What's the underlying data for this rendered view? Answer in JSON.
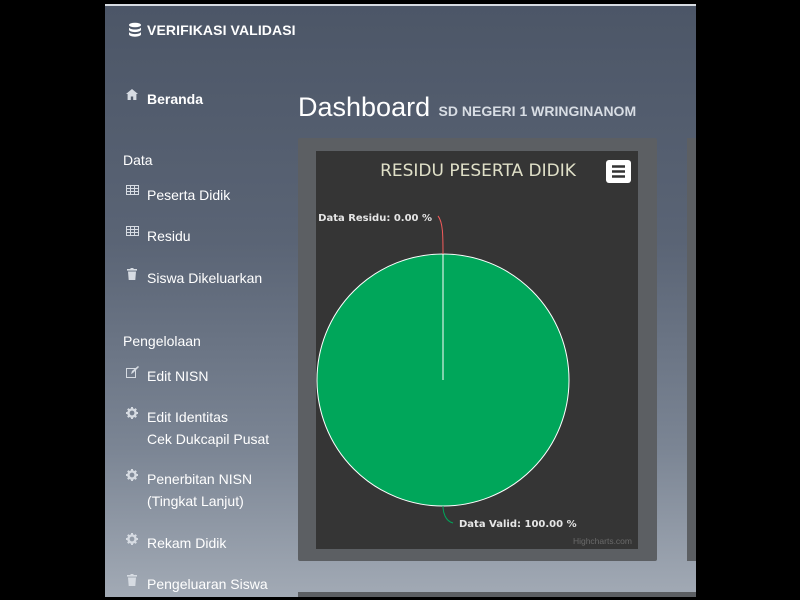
{
  "brand": {
    "icon": "database-icon",
    "title": "VERIFIKASI VALIDASI"
  },
  "sidebar": {
    "home": {
      "icon": "home-icon",
      "label": "Beranda"
    },
    "sections": [
      {
        "title": "Data",
        "items": [
          {
            "icon": "table-icon",
            "label": "Peserta Didik"
          },
          {
            "icon": "table-icon",
            "label": "Residu"
          },
          {
            "icon": "trash-icon",
            "label": "Siswa Dikeluarkan"
          }
        ]
      },
      {
        "title": "Pengelolaan",
        "items": [
          {
            "icon": "edit-icon",
            "label": "Edit NISN"
          },
          {
            "icon": "gear-icon",
            "label": "Edit Identitas",
            "label2": "Cek Dukcapil Pusat"
          },
          {
            "icon": "gear-icon",
            "label": "Penerbitan NISN",
            "label2": "(Tingkat Lanjut)"
          },
          {
            "icon": "gear-icon",
            "label": "Rekam Didik"
          },
          {
            "icon": "trash-icon",
            "label": "Pengeluaran Siswa"
          }
        ]
      }
    ]
  },
  "main": {
    "title": "Dashboard",
    "subtitle": "SD NEGERI 1 WRINGINANOM"
  },
  "chart_data": {
    "type": "pie",
    "title": "RESIDU PESERTA DIDIK",
    "menu_icon": "hamburger-menu-icon",
    "credits": "Highcharts.com",
    "slices": [
      {
        "name": "Data Residu",
        "value": 0.0,
        "label": "Data Residu: 0.00 %",
        "color": "#f45b5b"
      },
      {
        "name": "Data Valid",
        "value": 100.0,
        "label": "Data Valid: 100.00 %",
        "color": "#00a65a"
      }
    ],
    "colors": {
      "background": "#353535",
      "title": "#e0e0c8",
      "labels": "#e6e6e6"
    }
  }
}
